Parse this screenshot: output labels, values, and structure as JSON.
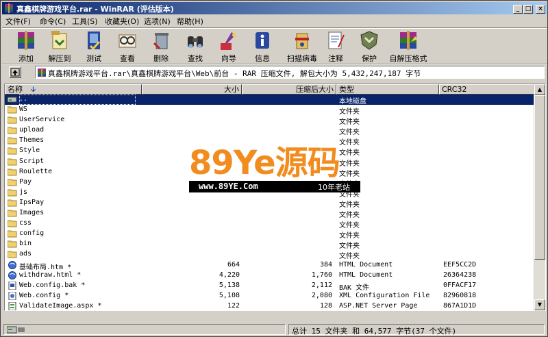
{
  "window": {
    "title": "真鑫棋牌游戏平台.rar - WinRAR (评估版本)",
    "controls": {
      "minimize": "_",
      "maximize": "□",
      "close": "×"
    }
  },
  "menu": [
    "文件(F)",
    "命令(C)",
    "工具(S)",
    "收藏夹(O)",
    "选项(N)",
    "帮助(H)"
  ],
  "toolbar": [
    {
      "label": "添加",
      "icon": "add-icon"
    },
    {
      "label": "解压到",
      "icon": "extract-to-icon"
    },
    {
      "label": "测试",
      "icon": "test-icon"
    },
    {
      "label": "查看",
      "icon": "view-icon"
    },
    {
      "label": "删除",
      "icon": "delete-icon"
    },
    {
      "label": "查找",
      "icon": "find-icon"
    },
    {
      "label": "向导",
      "icon": "wizard-icon"
    },
    {
      "label": "信息",
      "icon": "info-icon"
    },
    {
      "label": "扫描病毒",
      "icon": "virus-scan-icon"
    },
    {
      "label": "注释",
      "icon": "comment-icon"
    },
    {
      "label": "保护",
      "icon": "protect-icon"
    },
    {
      "label": "自解压格式",
      "icon": "sfx-icon"
    }
  ],
  "path": "真鑫棋牌游戏平台.rar\\真鑫棋牌游戏平台\\Web\\前台 - RAR 压缩文件, 解包大小为 5,432,247,187 字节",
  "columns": {
    "name": "名称",
    "size": "大小",
    "packed": "压缩后大小",
    "type": "类型",
    "crc": "CRC32"
  },
  "files": [
    {
      "name": "..",
      "size": "",
      "packed": "",
      "type": "本地磁盘",
      "crc": "",
      "kind": "parent",
      "selected": true
    },
    {
      "name": "WS",
      "size": "",
      "packed": "",
      "type": "文件夹",
      "crc": "",
      "kind": "folder"
    },
    {
      "name": "UserService",
      "size": "",
      "packed": "",
      "type": "文件夹",
      "crc": "",
      "kind": "folder"
    },
    {
      "name": "upload",
      "size": "",
      "packed": "",
      "type": "文件夹",
      "crc": "",
      "kind": "folder"
    },
    {
      "name": "Themes",
      "size": "",
      "packed": "",
      "type": "文件夹",
      "crc": "",
      "kind": "folder"
    },
    {
      "name": "Style",
      "size": "",
      "packed": "",
      "type": "文件夹",
      "crc": "",
      "kind": "folder"
    },
    {
      "name": "Script",
      "size": "",
      "packed": "",
      "type": "文件夹",
      "crc": "",
      "kind": "folder"
    },
    {
      "name": "Roulette",
      "size": "",
      "packed": "",
      "type": "文件夹",
      "crc": "",
      "kind": "folder"
    },
    {
      "name": "Pay",
      "size": "",
      "packed": "",
      "type": "文件夹",
      "crc": "",
      "kind": "folder"
    },
    {
      "name": "js",
      "size": "",
      "packed": "",
      "type": "文件夹",
      "crc": "",
      "kind": "folder"
    },
    {
      "name": "IpsPay",
      "size": "",
      "packed": "",
      "type": "文件夹",
      "crc": "",
      "kind": "folder"
    },
    {
      "name": "Images",
      "size": "",
      "packed": "",
      "type": "文件夹",
      "crc": "",
      "kind": "folder"
    },
    {
      "name": "css",
      "size": "",
      "packed": "",
      "type": "文件夹",
      "crc": "",
      "kind": "folder"
    },
    {
      "name": "config",
      "size": "",
      "packed": "",
      "type": "文件夹",
      "crc": "",
      "kind": "folder"
    },
    {
      "name": "bin",
      "size": "",
      "packed": "",
      "type": "文件夹",
      "crc": "",
      "kind": "folder"
    },
    {
      "name": "ads",
      "size": "",
      "packed": "",
      "type": "文件夹",
      "crc": "",
      "kind": "folder"
    },
    {
      "name": "基础布局.htm *",
      "size": "664",
      "packed": "384",
      "type": "HTML Document",
      "crc": "EEF5CC2D",
      "kind": "html"
    },
    {
      "name": "withdraw.html *",
      "size": "4,220",
      "packed": "1,760",
      "type": "HTML Document",
      "crc": "26364238",
      "kind": "html"
    },
    {
      "name": "Web.config.bak *",
      "size": "5,138",
      "packed": "2,112",
      "type": "BAK 文件",
      "crc": "0FFACF17",
      "kind": "bak"
    },
    {
      "name": "Web.config *",
      "size": "5,108",
      "packed": "2,080",
      "type": "XML Configuration File",
      "crc": "82960818",
      "kind": "config"
    },
    {
      "name": "ValidateImage.aspx *",
      "size": "122",
      "packed": "128",
      "type": "ASP.NET Server Page",
      "crc": "867A1D1D",
      "kind": "aspx"
    }
  ],
  "watermark": {
    "big": "89Ye源码",
    "url": "www.89YE.Com",
    "tag": "10年老站"
  },
  "status": {
    "right": "总计 15 文件夹 和 64,577 字节(37 个文件)"
  }
}
